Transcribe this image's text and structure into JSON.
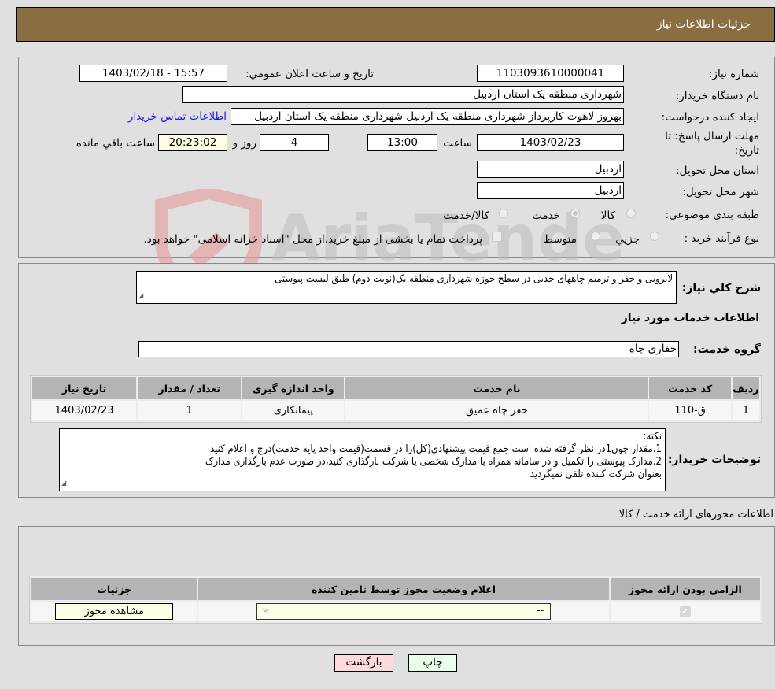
{
  "header": {
    "title": "جزئيات اطلاعات نیاز"
  },
  "form": {
    "need_number": {
      "label": "شماره نیاز:",
      "value": "1103093610000041"
    },
    "announce": {
      "label": "تاریخ و ساعت اعلان عمومي:",
      "value": "1403/02/18 - 15:57"
    },
    "buyer_org": {
      "label": "نام دستگاه خریدار:",
      "value": "شهرداری منطقه یک استان اردبیل"
    },
    "creator": {
      "label": "ایجاد کننده درخواست:",
      "value": "بهروز لاهوت کارپرداز شهرداری منطقه یک اردبیل شهرداری منطقه یک استان اردبیل"
    },
    "contact_link": "اطلاعات تماس خریدار",
    "deadline": {
      "label_line1": "مهلت ارسال پاسخ: تا",
      "label_line2": "تاریخ:",
      "date": "1403/02/23",
      "time_label": "ساعت",
      "time": "13:00",
      "days": "4",
      "days_label": "روز و",
      "remaining": "20:23:02",
      "remaining_label": "ساعت باقي مانده"
    },
    "province": {
      "label": "استان محل تحویل:",
      "value": "اردبیل"
    },
    "city": {
      "label": "شهر محل تحویل:",
      "value": "اردبیل"
    },
    "category": {
      "label": "طبقه بندی موضوعی:",
      "options": [
        {
          "label": "کالا",
          "selected": false
        },
        {
          "label": "خدمت",
          "selected": true
        },
        {
          "label": "کالا/خدمت",
          "selected": false
        }
      ]
    },
    "process": {
      "label": "نوع فرآیند خرید :",
      "options": [
        {
          "label": "جزيي",
          "selected": false
        },
        {
          "label": "متوسط",
          "selected": false
        }
      ],
      "treasury_checkbox_label": "پرداخت تمام یا بخشی از مبلغ خرید،از محل \"اسناد خزانه اسلامی\" خواهد بود.",
      "treasury_checked": false
    }
  },
  "description": {
    "label": "شرح کلي نیاز:",
    "value": "لایروبی و حفر و ترمیم چاههای جذبی در سطح حوزه شهرداری منطقه یک(نوبت دوم) طبق لیست پیوستی"
  },
  "services": {
    "section_title": "اطلاعات خدمات مورد نیاز",
    "group_label": "گروه خدمت:",
    "group_value": "حفاری چاه",
    "table": {
      "headers": [
        "ردیف",
        "کد خدمت",
        "نام خدمت",
        "واحد اندازه گیری",
        "تعداد / مقدار",
        "تاریخ نیاز"
      ],
      "rows": [
        [
          "1",
          "ق-110",
          "حفر چاه عمیق",
          "پیمانکاری",
          "1",
          "1403/02/23"
        ]
      ]
    }
  },
  "buyer_notes": {
    "label": "توضیحات خریدار:",
    "lines": [
      "نکته:",
      "1.مقدار چون1در نظر گرفته شده است جمع قیمت پیشنهادی(کل)را در قسمت(قیمت واحد پایه خدمت)درج و اعلام کنید",
      "2.مدارک پیوستی را تکمیل و در سامانه همراه با مدارک شخصی یا شرکت بارگذاری کنید،در صورت عدم بارگذاری مدارک",
      "بعنوان شرکت کننده تلقی نمیگردید"
    ]
  },
  "licenses": {
    "section_title": "اطلاعات مجوزهای ارائه خدمت / کالا",
    "headers": [
      "الزامی بودن ارائه مجوز",
      "اعلام وضعیت مجوز توسط تامین کننده",
      "جزئیات"
    ],
    "row": {
      "required_checked": true,
      "status_value": "--",
      "details_button": "مشاهده مجوز"
    }
  },
  "buttons": {
    "print": "چاپ",
    "back": "بازگشت"
  },
  "colors": {
    "header_bg": "#8b6d42",
    "link": "#1a1adc",
    "print_bg": "#eaffea",
    "back_bg": "#ffdada"
  }
}
